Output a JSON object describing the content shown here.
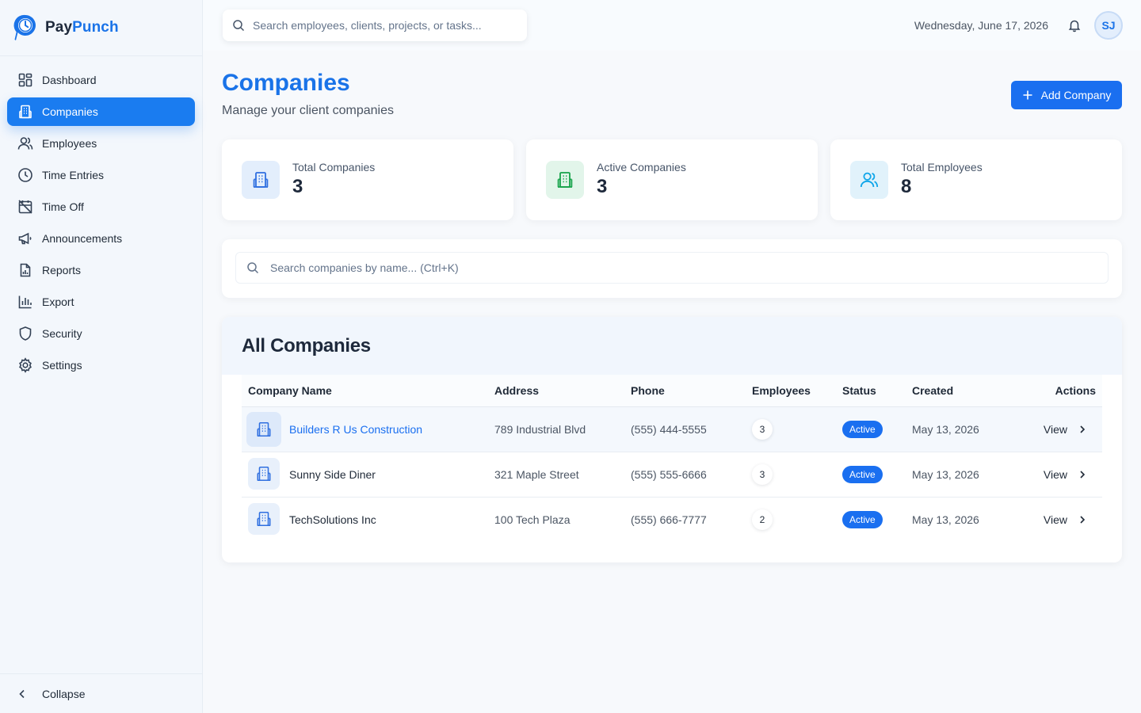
{
  "brand": {
    "name_part1": "Pay",
    "name_part2": "Punch"
  },
  "sidebar": {
    "items": [
      {
        "label": "Dashboard",
        "icon": "dashboard-icon"
      },
      {
        "label": "Companies",
        "icon": "building-icon",
        "active": true
      },
      {
        "label": "Employees",
        "icon": "users-icon"
      },
      {
        "label": "Time Entries",
        "icon": "clock-icon"
      },
      {
        "label": "Time Off",
        "icon": "calendar-off-icon"
      },
      {
        "label": "Announcements",
        "icon": "megaphone-icon"
      },
      {
        "label": "Reports",
        "icon": "report-icon"
      },
      {
        "label": "Export",
        "icon": "bar-chart-icon"
      },
      {
        "label": "Security",
        "icon": "shield-icon"
      },
      {
        "label": "Settings",
        "icon": "gear-icon"
      }
    ],
    "collapse_label": "Collapse"
  },
  "topbar": {
    "search_placeholder": "Search employees, clients, projects, or tasks...",
    "date": "Wednesday, June 17, 2026",
    "avatar_initials": "SJ"
  },
  "page": {
    "title": "Companies",
    "subtitle": "Manage your client companies",
    "add_button_label": "Add Company"
  },
  "stats": [
    {
      "label": "Total Companies",
      "value": "3",
      "icon": "building-icon"
    },
    {
      "label": "Active Companies",
      "value": "3",
      "icon": "building-icon"
    },
    {
      "label": "Total Employees",
      "value": "8",
      "icon": "users-icon"
    }
  ],
  "company_search": {
    "placeholder": "Search companies by name... (Ctrl+K)"
  },
  "table": {
    "title": "All Companies",
    "columns": [
      "Company Name",
      "Address",
      "Phone",
      "Employees",
      "Status",
      "Created",
      "Actions"
    ],
    "rows": [
      {
        "name": "Builders R Us Construction",
        "address": "789 Industrial Blvd",
        "phone": "(555) 444-5555",
        "employees": "3",
        "status": "Active",
        "created": "May 13, 2026",
        "action": "View"
      },
      {
        "name": "Sunny Side Diner",
        "address": "321 Maple Street",
        "phone": "(555) 555-6666",
        "employees": "3",
        "status": "Active",
        "created": "May 13, 2026",
        "action": "View"
      },
      {
        "name": "TechSolutions Inc",
        "address": "100 Tech Plaza",
        "phone": "(555) 666-7777",
        "employees": "2",
        "status": "Active",
        "created": "May 13, 2026",
        "action": "View"
      }
    ]
  },
  "colors": {
    "accent": "#1a6ff0",
    "sidebar_active": "#1a7cf0",
    "green": "#16a34a",
    "teal": "#0ea5e9"
  }
}
